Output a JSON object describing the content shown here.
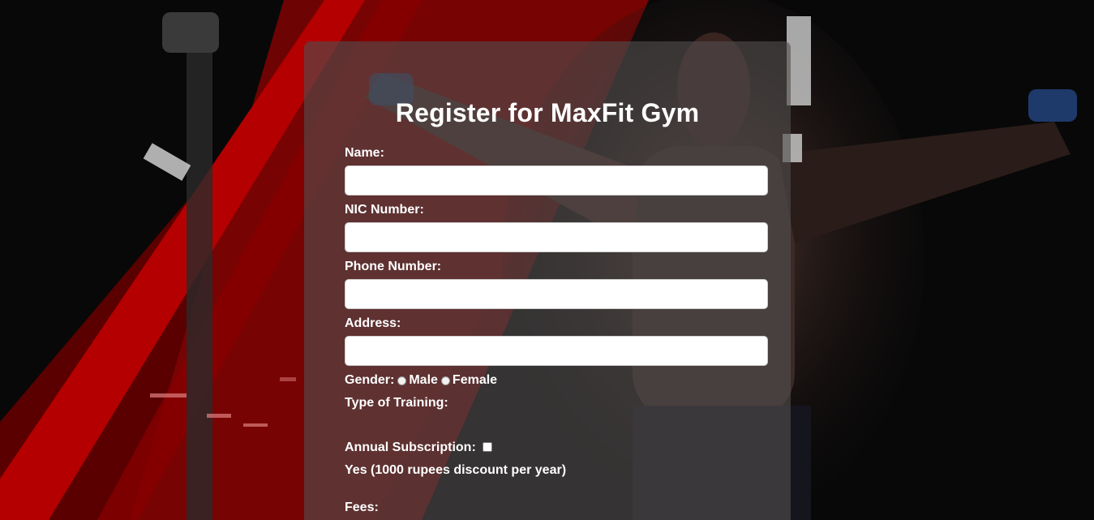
{
  "form": {
    "title": "Register for MaxFit Gym",
    "name_label": "Name:",
    "name_value": "",
    "nic_label": "NIC Number:",
    "nic_value": "",
    "phone_label": "Phone Number:",
    "phone_value": "",
    "address_label": "Address:",
    "address_value": "",
    "gender_label": "Gender:",
    "gender_options": [
      "Male",
      "Female"
    ],
    "training_label": "Type of Training:",
    "subscription_label": "Annual Subscription:",
    "subscription_checked": false,
    "subscription_note": "Yes (1000 rupees discount per year)",
    "fees_label": "Fees:"
  },
  "colors": {
    "accent_red": "#b00000",
    "card_background": "rgba(80,78,78,0.62)",
    "text": "#ffffff"
  }
}
